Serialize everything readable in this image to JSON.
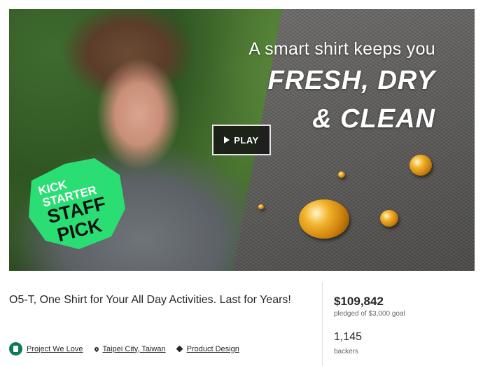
{
  "hero": {
    "line1": "A smart shirt keeps you",
    "line2": "FRESH, DRY",
    "line3": "& CLEAN",
    "play_label": "PLAY",
    "badge": {
      "kick": "KICK",
      "starter": "STARTER",
      "staff": "STAFF",
      "pick": "PICK",
      "color": "#2bde73"
    },
    "play_icon": "play-icon"
  },
  "project": {
    "title": "O5-T, One Shirt for Your All Day Activities. Last for Years!",
    "meta": [
      {
        "label": "Project We Love",
        "icon": "kickstarter-logo-icon"
      },
      {
        "label": "Taipei City, Taiwan",
        "icon": "location-pin-icon"
      },
      {
        "label": "Product Design",
        "icon": "tag-icon"
      }
    ]
  },
  "stats": {
    "pledged": "$109,842",
    "pledged_sub": "pledged of $3,000 goal",
    "backers": "1,145",
    "backers_label": "backers"
  },
  "colors": {
    "brand_green": "#2bde73",
    "text": "#282828",
    "muted": "#656969"
  }
}
